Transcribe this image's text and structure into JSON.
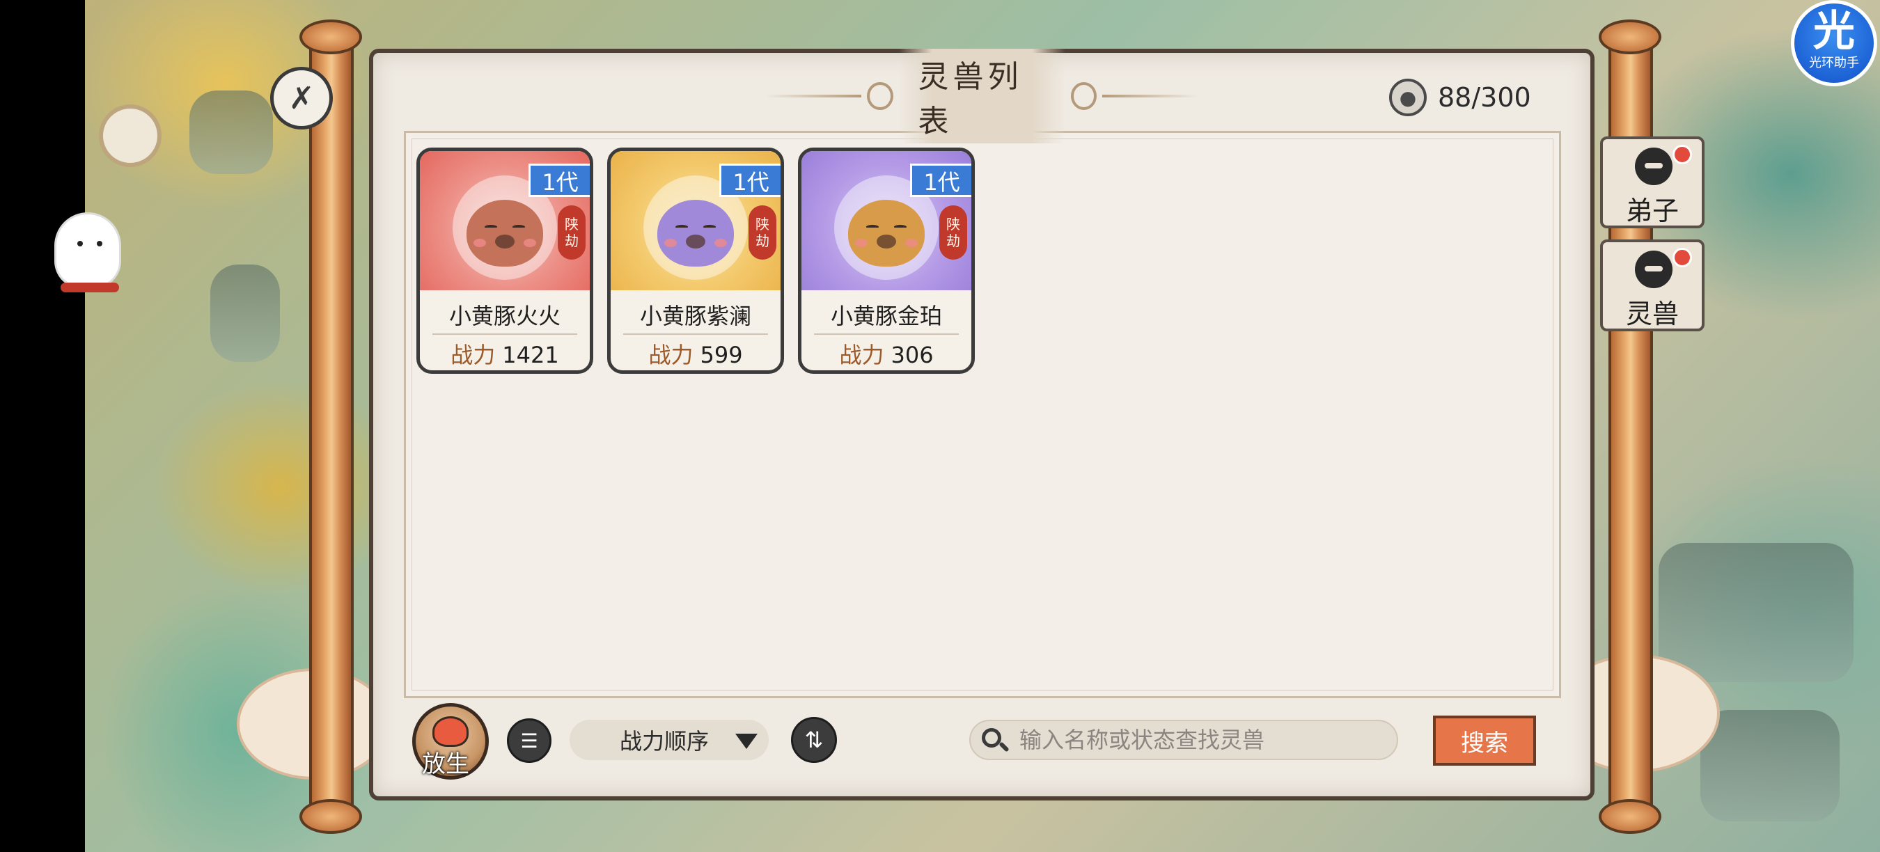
{
  "title": "灵兽列表",
  "capacity": "88/300",
  "cards": [
    {
      "gen": "1代",
      "seal": [
        "陕",
        "劫"
      ],
      "name": "小黄豚火火",
      "power_label": "战力",
      "power": "1421",
      "theme": "red",
      "body_color": "#c4735a"
    },
    {
      "gen": "1代",
      "seal": [
        "陕",
        "劫"
      ],
      "name": "小黄豚紫澜",
      "power_label": "战力",
      "power": "599",
      "theme": "yellow",
      "body_color": "#a089d8"
    },
    {
      "gen": "1代",
      "seal": [
        "陕",
        "劫"
      ],
      "name": "小黄豚金珀",
      "power_label": "战力",
      "power": "306",
      "theme": "purple",
      "body_color": "#d89b4a"
    }
  ],
  "toolbar": {
    "release_label": "放生",
    "sort_label": "战力顺序",
    "search_placeholder": "输入名称或状态查找灵兽",
    "search_button": "搜索"
  },
  "side_tabs": [
    {
      "label": "弟子"
    },
    {
      "label": "灵兽"
    }
  ],
  "helper": {
    "glyph": "光",
    "label": "光环助手"
  },
  "colors": {
    "accent_search": "#e6764a",
    "gen_badge": "#3a7bd5",
    "notification_dot": "#e24b3b",
    "power_label": "#9c5a2a"
  }
}
